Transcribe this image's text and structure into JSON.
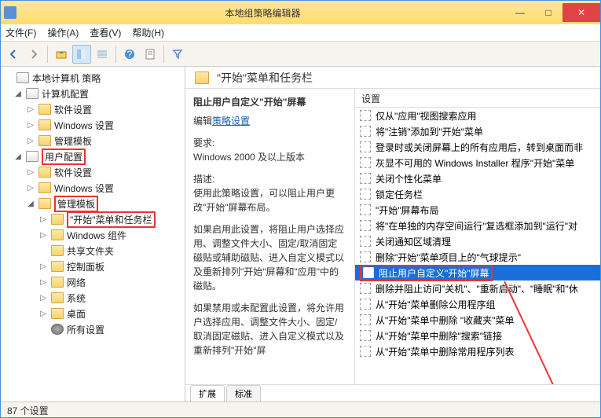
{
  "window": {
    "title": "本地组策略编辑器"
  },
  "menu": {
    "file": "文件(F)",
    "action": "操作(A)",
    "view": "查看(V)",
    "help": "帮助(H)"
  },
  "tree": {
    "root": "本地计算机 策略",
    "computer": "计算机配置",
    "c_software": "软件设置",
    "c_windows": "Windows 设置",
    "c_admin": "管理模板",
    "user": "用户配置",
    "u_software": "软件设置",
    "u_windows": "Windows 设置",
    "u_admin": "管理模板",
    "startmenu": "\"开始\"菜单和任务栏",
    "components": "Windows 组件",
    "shared": "共享文件夹",
    "ctrlpanel": "控制面板",
    "network": "网络",
    "system": "系统",
    "desktop": "桌面",
    "all": "所有设置"
  },
  "detail": {
    "header": "\"开始\"菜单和任务栏",
    "selected_title": "阻止用户自定义\"开始\"屏幕",
    "edit_label": "编辑",
    "edit_link": "策略设置",
    "req_label": "要求:",
    "req_value": "Windows 2000 及以上版本",
    "desc_label": "描述:",
    "desc_p1": "使用此策略设置，可以阻止用户更改\"开始\"屏幕布局。",
    "desc_p2": "如果启用此设置，将阻止用户选择应用、调整文件大小、固定/取消固定磁贴或辅助磁贴、进入自定义模式以及重新排列\"开始\"屏幕和\"应用\"中的磁贴。",
    "desc_p3": "如果禁用或未配置此设置，将允许用户选择应用、调整文件大小、固定/取消固定磁贴、进入自定义模式以及重新排列\"开始\"屏"
  },
  "list": {
    "header": "设置",
    "items": [
      "仅从\"应用\"视图搜索应用",
      "将\"注销\"添加到\"开始\"菜单",
      "登录时或关闭屏幕上的所有应用后，转到桌面而非",
      "灰显不可用的 Windows Installer 程序\"开始\"菜单",
      "关闭个性化菜单",
      "锁定任务栏",
      "\"开始\"屏幕布局",
      "将\"在单独的内存空间运行\"复选框添加到\"运行\"对",
      "关闭通知区域清理",
      "删除\"开始\"菜单项目上的\"气球提示\"",
      "阻止用户自定义\"开始\"屏幕",
      "删除并阻止访问\"关机\"、\"重新启动\"、\"睡眠\"和\"休",
      "从\"开始\"菜单删除公用程序组",
      "从\"开始\"菜单中删除 \"收藏夹\"菜单",
      "从\"开始\"菜单中删除\"搜索\"链接",
      "从\"开始\"菜单中删除常用程序列表"
    ],
    "selected_index": 10
  },
  "tabs": {
    "extended": "扩展",
    "standard": "标准"
  },
  "status": {
    "count": "87 个设置"
  }
}
